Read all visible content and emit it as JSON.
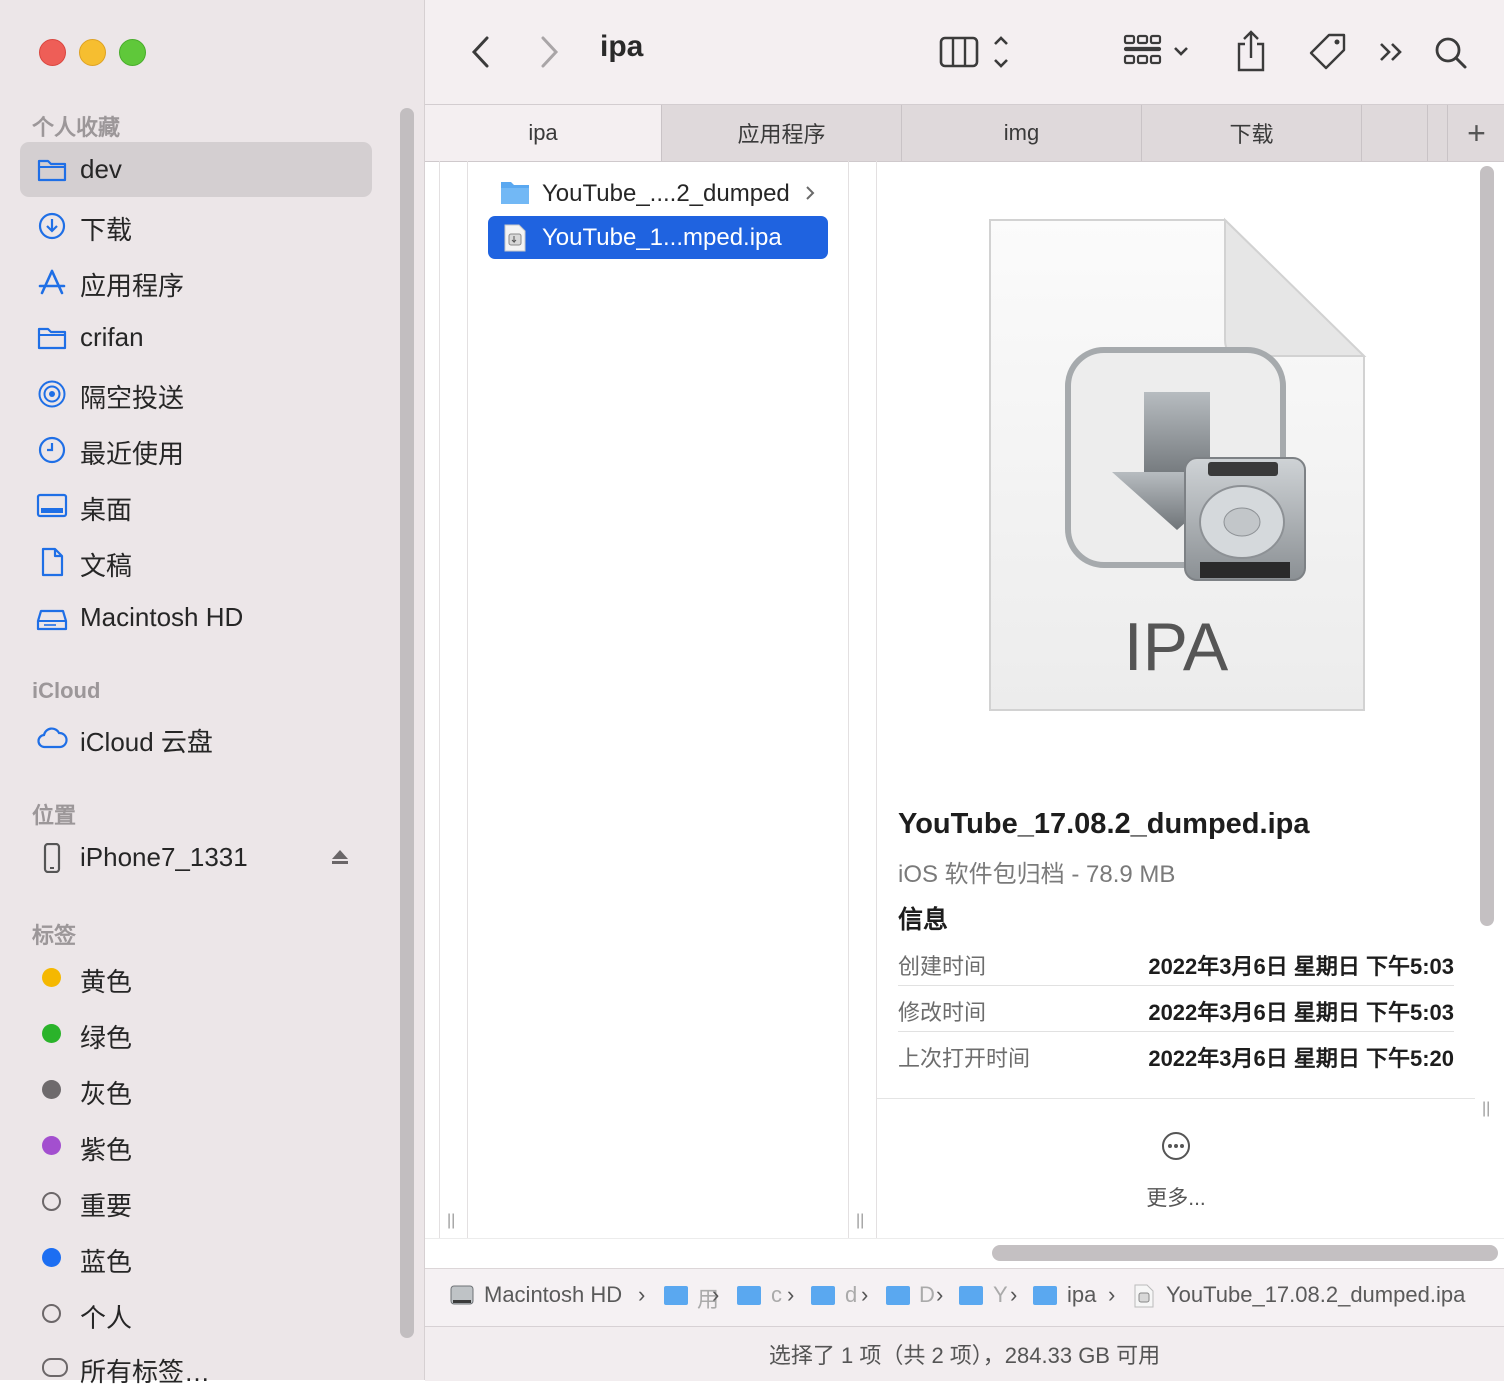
{
  "window": {
    "title": "ipa"
  },
  "sidebar": {
    "sections": {
      "favorites": "个人收藏",
      "icloud": "iCloud",
      "locations": "位置",
      "tags": "标签"
    },
    "favorites": [
      {
        "label": "dev",
        "icon": "folder-icon",
        "selected": true
      },
      {
        "label": "下载",
        "icon": "download-icon"
      },
      {
        "label": "应用程序",
        "icon": "applications-icon"
      },
      {
        "label": "crifan",
        "icon": "folder-icon"
      },
      {
        "label": "隔空投送",
        "icon": "airdrop-icon"
      },
      {
        "label": "最近使用",
        "icon": "clock-icon"
      },
      {
        "label": "桌面",
        "icon": "desktop-icon"
      },
      {
        "label": "文稿",
        "icon": "document-icon"
      },
      {
        "label": "Macintosh HD",
        "icon": "harddisk-icon"
      }
    ],
    "icloud_items": [
      {
        "label": "iCloud 云盘",
        "icon": "cloud-icon"
      }
    ],
    "locations": [
      {
        "label": "iPhone7_1331",
        "icon": "iphone-icon"
      }
    ],
    "tags": [
      {
        "label": "黄色",
        "color": "#f5b800"
      },
      {
        "label": "绿色",
        "color": "#2ab32a"
      },
      {
        "label": "灰色",
        "color": "#6e6a6c"
      },
      {
        "label": "紫色",
        "color": "#a34fcf"
      },
      {
        "label": "重要",
        "color": ""
      },
      {
        "label": "蓝色",
        "color": "#1c6ef2"
      },
      {
        "label": "个人",
        "color": ""
      },
      {
        "label": "所有标签…",
        "color": ""
      }
    ]
  },
  "tabs": [
    {
      "label": "ipa",
      "active": true
    },
    {
      "label": "应用程序"
    },
    {
      "label": "img"
    },
    {
      "label": "下载"
    }
  ],
  "column": {
    "items": [
      {
        "label": "YouTube_....2_dumped",
        "kind": "folder"
      },
      {
        "label": "YouTube_1...mped.ipa",
        "kind": "ipa",
        "selected": true
      }
    ]
  },
  "preview": {
    "icon_text": "IPA",
    "filename": "YouTube_17.08.2_dumped.ipa",
    "kind_size": "iOS 软件包归档 - 78.9 MB",
    "info_header": "信息",
    "rows": [
      {
        "key": "创建时间",
        "value": "2022年3月6日 星期日 下午5:03"
      },
      {
        "key": "修改时间",
        "value": "2022年3月6日 星期日 下午5:03"
      },
      {
        "key": "上次打开时间",
        "value": "2022年3月6日 星期日 下午5:20"
      }
    ],
    "more_label": "更多..."
  },
  "pathbar": {
    "root": "Macintosh HD",
    "truncated": [
      "用",
      "c",
      "d",
      "D",
      "Y"
    ],
    "ipa": "ipa",
    "file": "YouTube_17.08.2_dumped.ipa"
  },
  "status": "选择了 1 项（共 2 项），284.33 GB 可用",
  "colors": {
    "accent": "#1f63e0",
    "sidebar_bg": "#ece6e8",
    "folder_blue": "#5aa8f0"
  }
}
